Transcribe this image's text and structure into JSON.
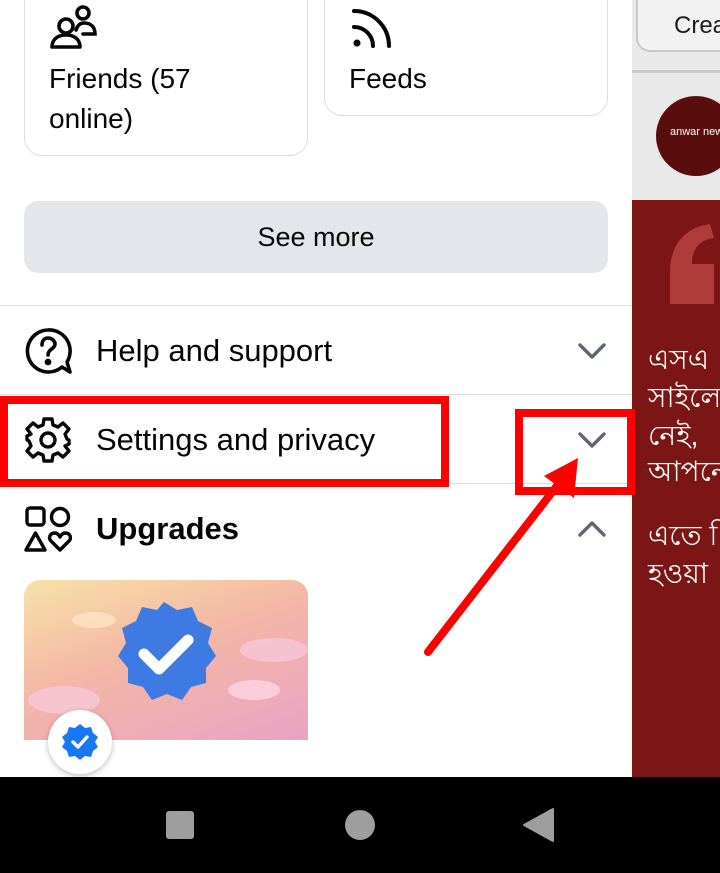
{
  "shortcuts": {
    "friends_label": "Friends (57 online)",
    "friends_icon": "friends-icon",
    "feeds_label": "Feeds",
    "feeds_icon": "rss-icon"
  },
  "see_more_label": "See more",
  "menu_rows": {
    "help": {
      "label": "Help and support",
      "icon": "question-icon",
      "expanded": false
    },
    "settings": {
      "label": "Settings and privacy",
      "icon": "gear-icon",
      "expanded": false
    },
    "upgrades": {
      "label": "Upgrades",
      "icon": "shapes-icon",
      "expanded": true
    }
  },
  "background_feed": {
    "create_label": "Crea",
    "avatar_text": "anwar news",
    "text_lines": [
      "এসএ",
      "সাইলে",
      "নেই, ",
      "আপনে",
      "এতে ি",
      "হওয়া"
    ]
  },
  "annotation_color": "#ff0000",
  "nav_buttons": [
    "recents-square",
    "home-circle",
    "back-triangle"
  ]
}
